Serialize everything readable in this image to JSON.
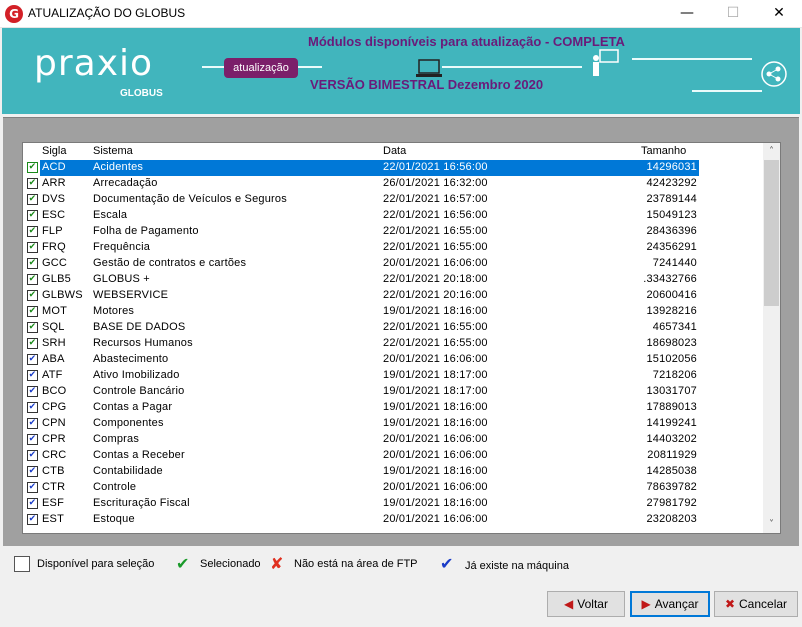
{
  "window": {
    "title": "ATUALIZAÇÃO DO GLOBUS",
    "app_icon": "G",
    "minimize": "—",
    "maximize": "☐",
    "close": "✕"
  },
  "banner": {
    "logo": "praxio",
    "product": "GLOBUS",
    "pill": "atualização",
    "title": "Módulos disponíveis para atualização - COMPLETA",
    "version": "VERSÃO BIMESTRAL Dezembro 2020",
    "icons": [
      "laptop-icon",
      "presenter-icon",
      "share-network-icon"
    ],
    "colors": {
      "background": "#41b5bd",
      "accent": "#7b1f6a",
      "text": "#6a1b7a"
    }
  },
  "table": {
    "headers": {
      "sigla": "Sigla",
      "sistema": "Sistema",
      "data": "Data",
      "tamanho": "Tamanho"
    },
    "rows": [
      {
        "sigla": "ACD",
        "sistema": "Acidentes",
        "data": "22/01/2021 16:56:00",
        "tamanho": "14296031",
        "check": "green",
        "selected": true
      },
      {
        "sigla": "ARR",
        "sistema": "Arrecadação",
        "data": "26/01/2021 16:32:00",
        "tamanho": "42423292",
        "check": "green"
      },
      {
        "sigla": "DVS",
        "sistema": "Documentação de Veículos e Seguros",
        "data": "22/01/2021 16:57:00",
        "tamanho": "23789144",
        "check": "green"
      },
      {
        "sigla": "ESC",
        "sistema": "Escala",
        "data": "22/01/2021 16:56:00",
        "tamanho": "15049123",
        "check": "green"
      },
      {
        "sigla": "FLP",
        "sistema": "Folha de Pagamento",
        "data": "22/01/2021 16:55:00",
        "tamanho": "28436396",
        "check": "green"
      },
      {
        "sigla": "FRQ",
        "sistema": "Frequência",
        "data": "22/01/2021 16:55:00",
        "tamanho": "24356291",
        "check": "green"
      },
      {
        "sigla": "GCC",
        "sistema": "Gestão de contratos e cartões",
        "data": "20/01/2021 16:06:00",
        "tamanho": "7241440",
        "check": "green"
      },
      {
        "sigla": "GLB5",
        "sistema": "GLOBUS +",
        "data": "22/01/2021 20:18:00",
        "tamanho": ".33432766",
        "check": "green"
      },
      {
        "sigla": "GLBWS",
        "sistema": "WEBSERVICE",
        "data": "22/01/2021 20:16:00",
        "tamanho": "20600416",
        "check": "green"
      },
      {
        "sigla": "MOT",
        "sistema": "Motores",
        "data": "19/01/2021 18:16:00",
        "tamanho": "13928216",
        "check": "green"
      },
      {
        "sigla": "SQL",
        "sistema": "BASE DE DADOS",
        "data": "22/01/2021 16:55:00",
        "tamanho": "4657341",
        "check": "green"
      },
      {
        "sigla": "SRH",
        "sistema": "Recursos Humanos",
        "data": "22/01/2021 16:55:00",
        "tamanho": "18698023",
        "check": "green"
      },
      {
        "sigla": "ABA",
        "sistema": "Abastecimento",
        "data": "20/01/2021 16:06:00",
        "tamanho": "15102056",
        "check": "blue"
      },
      {
        "sigla": "ATF",
        "sistema": "Ativo Imobilizado",
        "data": "19/01/2021 18:17:00",
        "tamanho": "7218206",
        "check": "blue"
      },
      {
        "sigla": "BCO",
        "sistema": "Controle Bancário",
        "data": "19/01/2021 18:17:00",
        "tamanho": "13031707",
        "check": "blue"
      },
      {
        "sigla": "CPG",
        "sistema": "Contas a Pagar",
        "data": "19/01/2021 18:16:00",
        "tamanho": "17889013",
        "check": "blue"
      },
      {
        "sigla": "CPN",
        "sistema": "Componentes",
        "data": "19/01/2021 18:16:00",
        "tamanho": "14199241",
        "check": "blue"
      },
      {
        "sigla": "CPR",
        "sistema": "Compras",
        "data": "20/01/2021 16:06:00",
        "tamanho": "14403202",
        "check": "blue"
      },
      {
        "sigla": "CRC",
        "sistema": "Contas a Receber",
        "data": "20/01/2021 16:06:00",
        "tamanho": "20811929",
        "check": "blue"
      },
      {
        "sigla": "CTB",
        "sistema": "Contabilidade",
        "data": "19/01/2021 18:16:00",
        "tamanho": "14285038",
        "check": "blue"
      },
      {
        "sigla": "CTR",
        "sistema": "Controle",
        "data": "20/01/2021 16:06:00",
        "tamanho": "78639782",
        "check": "blue"
      },
      {
        "sigla": "ESF",
        "sistema": "Escrituração Fiscal",
        "data": "19/01/2021 18:16:00",
        "tamanho": "27981792",
        "check": "blue"
      },
      {
        "sigla": "EST",
        "sistema": "Estoque",
        "data": "20/01/2021 16:06:00",
        "tamanho": "23208203",
        "check": "blue"
      }
    ],
    "scroll_up": "˄",
    "scroll_down": "˅"
  },
  "legend": {
    "available": "Disponível para seleção",
    "selected": "Selecionado",
    "not_in_ftp": "Não está na área de FTP",
    "exists": "Já existe na máquina",
    "icons": {
      "selected": "✔",
      "not_in_ftp": "✘",
      "exists": "✔"
    }
  },
  "buttons": {
    "voltar": "Voltar",
    "avancar": "Avançar",
    "cancelar": "Cancelar",
    "voltar_icon": "◀",
    "avancar_icon": "▶",
    "cancelar_icon": "✖"
  }
}
